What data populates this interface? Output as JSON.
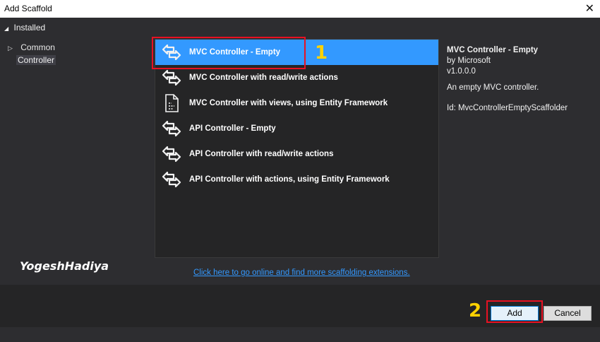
{
  "window": {
    "title": "Add Scaffold",
    "close_glyph": "✕"
  },
  "tree": {
    "installed_label": "Installed",
    "items": [
      {
        "label": "Common"
      },
      {
        "label": "Controller"
      }
    ]
  },
  "list": {
    "items": [
      {
        "label": "MVC Controller - Empty",
        "icon": "controller-icon"
      },
      {
        "label": "MVC Controller with read/write actions",
        "icon": "controller-icon"
      },
      {
        "label": "MVC Controller with views, using Entity Framework",
        "icon": "views-document-icon"
      },
      {
        "label": "API Controller - Empty",
        "icon": "controller-icon"
      },
      {
        "label": "API Controller with read/write actions",
        "icon": "controller-icon"
      },
      {
        "label": "API Controller with actions, using Entity Framework",
        "icon": "controller-icon"
      }
    ]
  },
  "details": {
    "name": "MVC Controller - Empty",
    "author": "by Microsoft",
    "version": "v1.0.0.0",
    "description": "An empty MVC controller.",
    "id": "Id: MvcControllerEmptyScaffolder"
  },
  "watermark": "YogeshHadiya",
  "online_link": "Click here to go online and find more scaffolding extensions.",
  "buttons": {
    "add": "Add",
    "cancel": "Cancel"
  },
  "annotations": {
    "marker_1": "1",
    "marker_2": "2"
  },
  "colors": {
    "selection": "#3399ff",
    "highlight": "#e81123",
    "marker": "#ffd200"
  }
}
